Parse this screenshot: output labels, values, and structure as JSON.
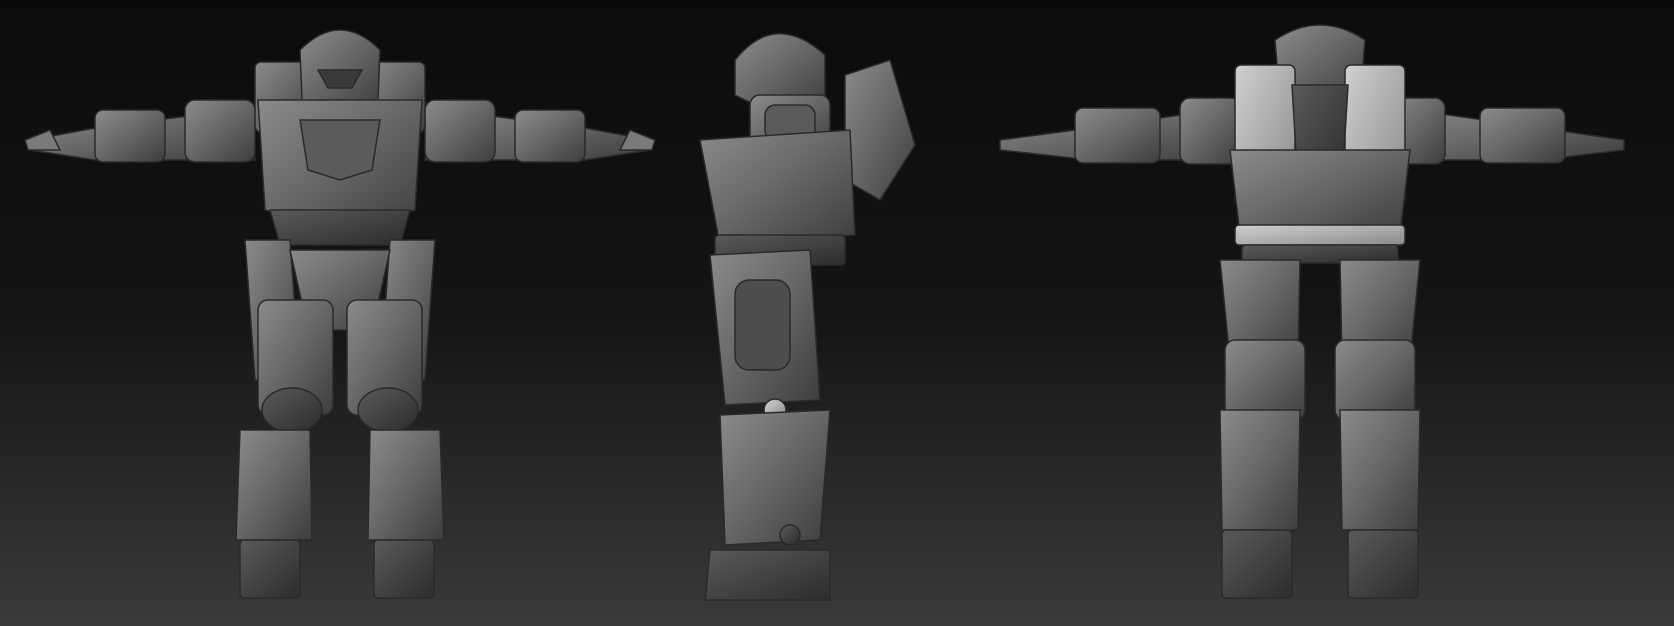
{
  "scene": {
    "background_top": "#0b0b0b",
    "background_bottom": "#3a3a3a",
    "armor_color": "#707070",
    "highlight_color": "#b9b9b9",
    "shadow_color": "#2a2a2a"
  },
  "views": [
    {
      "name": "front-view"
    },
    {
      "name": "side-view"
    },
    {
      "name": "back-view"
    }
  ]
}
